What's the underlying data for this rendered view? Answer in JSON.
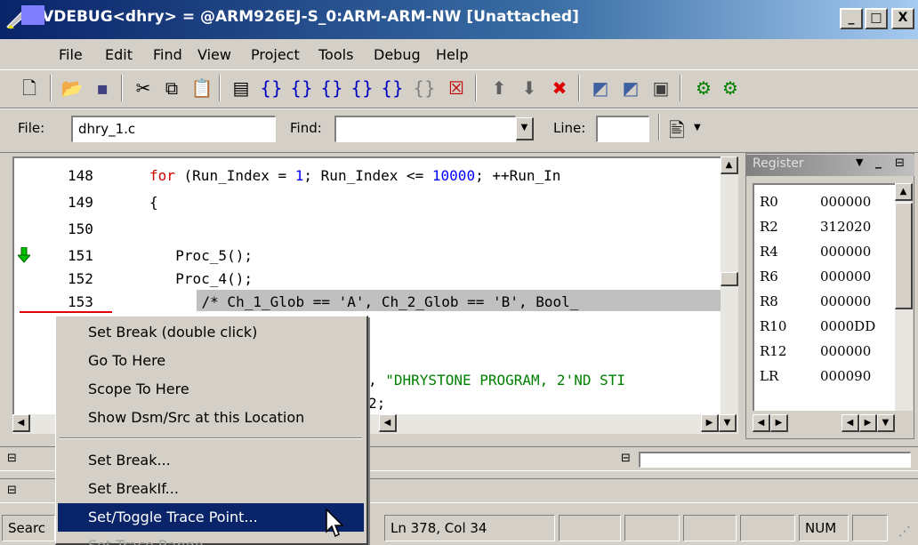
{
  "window": {
    "title": "RVDEBUG<dhry> = @ARM926EJ-S_0:ARM-ARM-NW [Unattached]",
    "minimize": "_",
    "maximize": "□",
    "close": "X"
  },
  "menu": [
    "File",
    "Edit",
    "Find",
    "View",
    "Project",
    "Tools",
    "Debug",
    "Help"
  ],
  "toolbar": {
    "icons": [
      "new-file-icon",
      "open-folder-icon",
      "save-icon",
      "cut-icon",
      "copy-icon",
      "paste-icon",
      "step-icon",
      "step-into-icon",
      "step-over-icon",
      "step-out-icon",
      "run-to-icon",
      "step-return-icon",
      "stop-icon",
      "break-icon",
      "up-arrow-icon",
      "down-arrow-icon",
      "delete-icon",
      "load-icon",
      "reload-icon",
      "connect-icon",
      "register-icon",
      "mem-icon"
    ]
  },
  "filebar": {
    "file_label": "File:",
    "file_value": "dhry_1.c",
    "find_label": "Find:",
    "find_value": "",
    "line_label": "Line:",
    "line_value": ""
  },
  "code": {
    "lines": [
      {
        "n": "148",
        "text_kw": "for",
        "text_a": " (Run_Index = ",
        "num1": "1",
        "text_b": "; Run_Index <= ",
        "num2": "10000",
        "text_c": "; ++Run_In"
      },
      {
        "n": "149",
        "text": "{"
      },
      {
        "n": "150",
        "text": ""
      },
      {
        "n": "151",
        "text": "  Proc_5();"
      },
      {
        "n": "152",
        "text": "  Proc_4();"
      },
      {
        "n": "153",
        "text": "    /* Ch_1_Glob == 'A', Ch_2_Glob == 'B', Bool_"
      }
    ],
    "partial1_prefix": ", ",
    "partial1_str": "\"DHRYSTONE PROGRAM, 2'ND STI",
    "partial2": "2;"
  },
  "registers": {
    "title": "Register",
    "rows": [
      {
        "name": "R0",
        "value": "000000"
      },
      {
        "name": "R2",
        "value": "312020"
      },
      {
        "name": "R4",
        "value": "000000"
      },
      {
        "name": "R6",
        "value": "000000"
      },
      {
        "name": "R8",
        "value": "000000"
      },
      {
        "name": "R10",
        "value": "0000DD"
      },
      {
        "name": "R12",
        "value": "000000"
      },
      {
        "name": "LR",
        "value": "000090"
      }
    ]
  },
  "context_menu": {
    "items": [
      "Set Break (double click)",
      "Go To Here",
      "Scope To Here",
      "Show Dsm/Src at this Location",
      "Set Break...",
      "Set BreakIf...",
      "Set/Toggle Trace Point...",
      "Set Trace Range..."
    ]
  },
  "status": {
    "search": "Searc",
    "position": "Ln 378, Col 34",
    "num": "NUM"
  },
  "colors": {
    "title_bar": "#0a246a",
    "menu_highlight": "#0a246a",
    "keyword": "#d00000",
    "number": "#0000ff",
    "string": "#008000"
  }
}
